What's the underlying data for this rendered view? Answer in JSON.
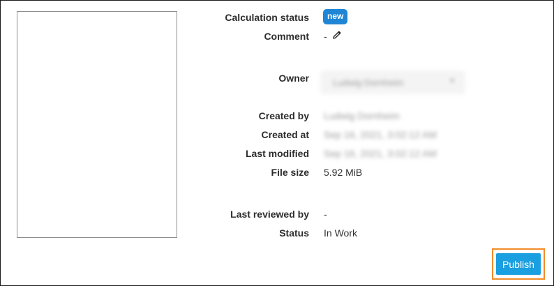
{
  "details": {
    "calculation_status_label": "Calculation status",
    "calculation_status_badge": "new",
    "comment_label": "Comment",
    "comment_value": "-",
    "owner_label": "Owner",
    "owner_value": "Ludwig Dornheim",
    "created_by_label": "Created by",
    "created_by_value": "Ludwig Dornheim",
    "created_at_label": "Created at",
    "created_at_value": "Sep 16, 2021, 3:02:12 AM",
    "last_modified_label": "Last modified",
    "last_modified_value": "Sep 16, 2021, 3:02:12 AM",
    "file_size_label": "File size",
    "file_size_value": "5.92 MiB",
    "last_reviewed_by_label": "Last reviewed by",
    "last_reviewed_by_value": "-",
    "status_label": "Status",
    "status_value": "In Work"
  },
  "actions": {
    "publish_label": "Publish"
  },
  "colors": {
    "badge": "#1f86d6",
    "publish_button": "#1a9fe0",
    "highlight_border": "#f28c28"
  },
  "icons": {
    "comment_edit": "pencil-icon",
    "owner_dropdown": "chevron-down-icon"
  }
}
